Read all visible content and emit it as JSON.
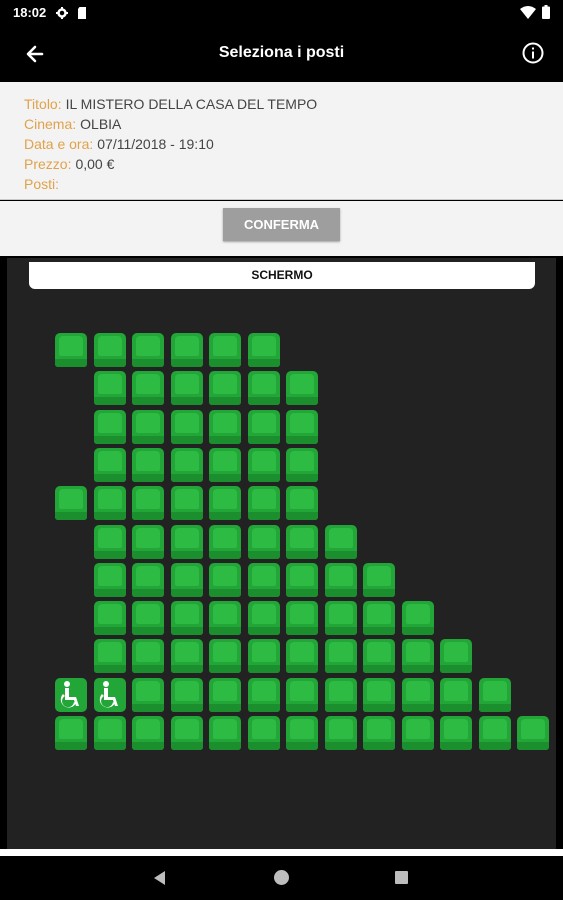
{
  "status_bar": {
    "time": "18:02",
    "left_icons": [
      "gear-icon",
      "sd-card-icon"
    ],
    "right_icons": [
      "wifi-icon",
      "battery-icon"
    ]
  },
  "app_bar": {
    "title": "Seleziona i posti",
    "back_icon": "arrow-left-icon",
    "info_icon": "info-icon"
  },
  "movie_info": {
    "title_label": "Titolo:",
    "title_value": "IL MISTERO DELLA CASA DEL TEMPO",
    "cinema_label": "Cinema:",
    "cinema_value": "OLBIA",
    "datetime_label": "Data e ora:",
    "datetime_value": "07/11/2018 - 19:10",
    "price_label": "Prezzo:",
    "price_value": "0,00 €",
    "seats_label": "Posti:",
    "seats_value": ""
  },
  "confirm_button": "CONFERMA",
  "hall": {
    "screen_label": "SCHERMO",
    "colors": {
      "available": "#21a637",
      "background": "#222222"
    },
    "rows": [
      [
        "a",
        "a",
        "a",
        "a",
        "a",
        "a",
        "-",
        "-",
        "-",
        "-",
        "-",
        "-",
        "-"
      ],
      [
        "-",
        "a",
        "a",
        "a",
        "a",
        "a",
        "a",
        "-",
        "-",
        "-",
        "-",
        "-",
        "-"
      ],
      [
        "-",
        "a",
        "a",
        "a",
        "a",
        "a",
        "a",
        "-",
        "-",
        "-",
        "-",
        "-",
        "-"
      ],
      [
        "-",
        "a",
        "a",
        "a",
        "a",
        "a",
        "a",
        "-",
        "-",
        "-",
        "-",
        "-",
        "-"
      ],
      [
        "a",
        "a",
        "a",
        "a",
        "a",
        "a",
        "a",
        "-",
        "-",
        "-",
        "-",
        "-",
        "-"
      ],
      [
        "-",
        "a",
        "a",
        "a",
        "a",
        "a",
        "a",
        "a",
        "-",
        "-",
        "-",
        "-",
        "-"
      ],
      [
        "-",
        "a",
        "a",
        "a",
        "a",
        "a",
        "a",
        "a",
        "a",
        "-",
        "-",
        "-",
        "-"
      ],
      [
        "-",
        "a",
        "a",
        "a",
        "a",
        "a",
        "a",
        "a",
        "a",
        "a",
        "-",
        "-",
        "-"
      ],
      [
        "-",
        "a",
        "a",
        "a",
        "a",
        "a",
        "a",
        "a",
        "a",
        "a",
        "a",
        "-",
        "-"
      ],
      [
        "w",
        "w",
        "a",
        "a",
        "a",
        "a",
        "a",
        "a",
        "a",
        "a",
        "a",
        "a",
        "-"
      ],
      [
        "a",
        "a",
        "a",
        "a",
        "a",
        "a",
        "a",
        "a",
        "a",
        "a",
        "a",
        "a",
        "a"
      ]
    ],
    "legend": {
      "a": "available",
      "w": "wheelchair",
      "-": "no seat"
    }
  },
  "nav_bar": {
    "icons": [
      "nav-back-icon",
      "nav-home-icon",
      "nav-recents-icon"
    ]
  }
}
